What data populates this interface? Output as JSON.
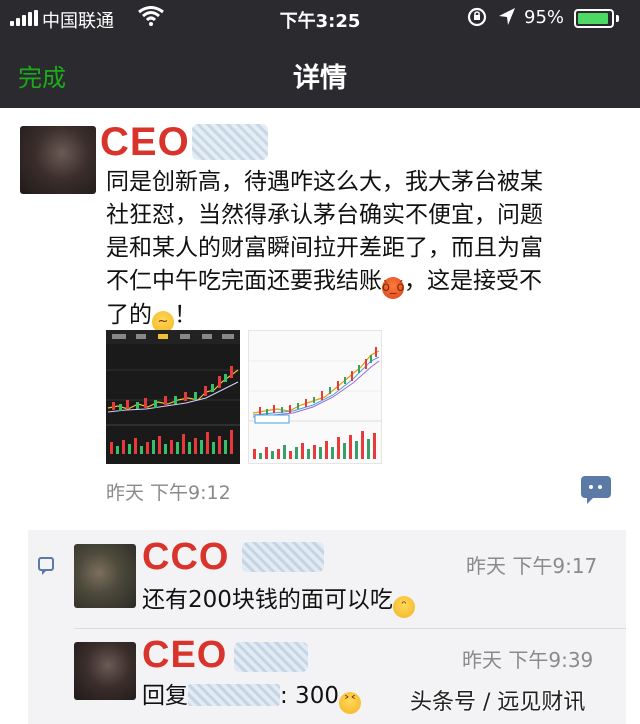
{
  "status_bar": {
    "carrier": "中国联通",
    "time": "下午3:25",
    "battery_percent": "95%",
    "battery_level": 0.95
  },
  "nav": {
    "done_label": "完成",
    "title": "详情"
  },
  "post": {
    "author": "CEO",
    "text_lines": [
      "同是创新高，待遇咋这么大，我大茅台被某",
      "社狂怼，当然得承认茅台确实不便宜，问题",
      "是和某人的财富瞬间拉开差距了，而且为富",
      "不仁中午吃完面还要我结账"
    ],
    "text_tail_1": "，这是接受不",
    "text_tail_2": "了的",
    "text_tail_3": "！",
    "timestamp": "昨天 下午9:12"
  },
  "comments": [
    {
      "author": "CCO",
      "time": "昨天 下午9:17",
      "text": "还有200块钱的面可以吃"
    },
    {
      "author": "CEO",
      "time": "昨天 下午9:39",
      "reply_prefix": "回复",
      "reply_suffix": ": 300"
    }
  ],
  "watermark": "头条号 / 远见财讯",
  "colors": {
    "nav_bg": "#2b2b2f",
    "done_green": "#1aad19",
    "name_red": "#d9342b",
    "link_blue": "#5b7aa5",
    "battery_green": "#4cd964"
  },
  "icons": [
    "signal-icon",
    "wifi-icon",
    "rotation-lock-icon",
    "location-icon",
    "battery-icon",
    "comment-icon",
    "angry-emoji-icon",
    "thinking-emoji-icon",
    "grin-emoji-icon",
    "cry-laugh-emoji-icon"
  ]
}
